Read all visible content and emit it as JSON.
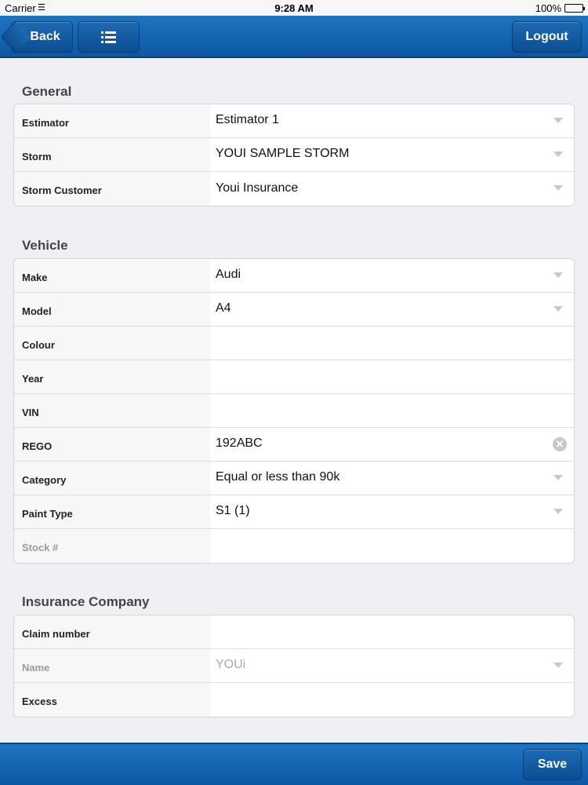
{
  "status_bar": {
    "carrier": "Carrier",
    "time": "9:28 AM",
    "battery": "100%"
  },
  "nav": {
    "back_label": "Back",
    "logout_label": "Logout",
    "menu_icon": "list-icon"
  },
  "sections": {
    "general": {
      "title": "General",
      "rows": [
        {
          "label": "Estimator",
          "value": "Estimator 1",
          "control": "dropdown"
        },
        {
          "label": "Storm",
          "value": "YOUI SAMPLE STORM",
          "control": "dropdown"
        },
        {
          "label": "Storm Customer",
          "value": "Youi Insurance",
          "control": "dropdown"
        }
      ]
    },
    "vehicle": {
      "title": "Vehicle",
      "rows": [
        {
          "label": "Make",
          "value": "Audi",
          "control": "dropdown"
        },
        {
          "label": "Model",
          "value": "A4",
          "control": "dropdown"
        },
        {
          "label": "Colour",
          "value": "",
          "control": "text"
        },
        {
          "label": "Year",
          "value": "",
          "control": "text"
        },
        {
          "label": "VIN",
          "value": "",
          "control": "text"
        },
        {
          "label": "REGO",
          "value": "192ABC",
          "control": "text-clear"
        },
        {
          "label": "Category",
          "value": "Equal or less than 90k",
          "control": "dropdown"
        },
        {
          "label": "Paint Type",
          "value": "S1 (1)",
          "control": "dropdown"
        },
        {
          "label": "Stock #",
          "value": "",
          "control": "text-disabled"
        }
      ]
    },
    "insurance": {
      "title": "Insurance Company",
      "rows": [
        {
          "label": "Claim number",
          "value": "",
          "control": "text"
        },
        {
          "label": "Name",
          "value": "YOUi",
          "control": "dropdown-disabled"
        },
        {
          "label": "Excess",
          "value": "",
          "control": "text"
        }
      ]
    }
  },
  "footer": {
    "save_label": "Save"
  },
  "colors": {
    "bar_blue": "#0b57a3",
    "background": "#efeff4"
  }
}
